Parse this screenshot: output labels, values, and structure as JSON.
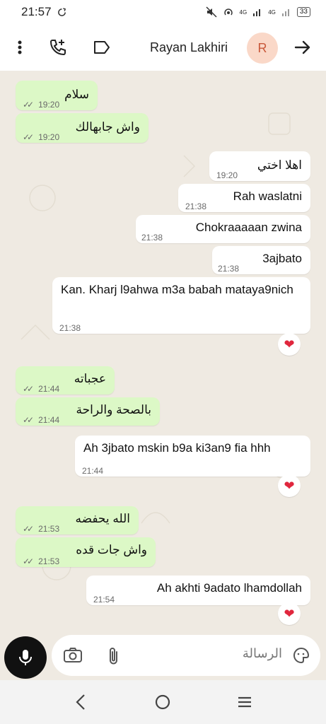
{
  "status_bar": {
    "time": "21:57",
    "network_1": "4G",
    "network_2": "4G",
    "battery": "33"
  },
  "header": {
    "contact_name": "Rayan Lakhiri",
    "avatar_letter": "R"
  },
  "messages": [
    {
      "dir": "out",
      "text": "سلام",
      "time": "19:20",
      "ticks": "✓✓"
    },
    {
      "dir": "out",
      "text": "واش جابهالك",
      "time": "19:20",
      "ticks": "✓✓"
    },
    {
      "dir": "in",
      "text": "اهلا اختي",
      "time": "19:20"
    },
    {
      "dir": "in",
      "text": "Rah waslatni",
      "time": "21:38"
    },
    {
      "dir": "in",
      "text": "Chokraaaaan zwina",
      "time": "21:38"
    },
    {
      "dir": "in",
      "text": "3ajbato",
      "time": "21:38"
    },
    {
      "dir": "in",
      "text": "Kan. Kharj l9ahwa m3a babah mataya9nich",
      "time": "21:38",
      "reaction": "❤"
    },
    {
      "dir": "out",
      "text": "عجباته",
      "time": "21:44",
      "ticks": "✓✓"
    },
    {
      "dir": "out",
      "text": "بالصحة والراحة",
      "time": "21:44",
      "ticks": "✓✓"
    },
    {
      "dir": "in",
      "text": "Ah 3jbato mskin b9a ki3an9 fia hhh",
      "time": "21:44",
      "reaction": "❤"
    },
    {
      "dir": "out",
      "text": "الله يحفضه",
      "time": "21:53",
      "ticks": "✓✓"
    },
    {
      "dir": "out",
      "text": "واش جات قده",
      "time": "21:53",
      "ticks": "✓✓"
    },
    {
      "dir": "in",
      "text": "Ah akhti 9adato lhamdollah",
      "time": "21:54",
      "reaction": "❤"
    }
  ],
  "composer": {
    "placeholder": "الرسالة"
  },
  "icons": {
    "more": "more-vert-icon",
    "call": "add-call-icon",
    "label": "label-icon",
    "back": "arrow-icon",
    "mic": "mic-icon",
    "camera": "camera-icon",
    "attach": "paperclip-icon",
    "sticker": "sticker-icon"
  }
}
